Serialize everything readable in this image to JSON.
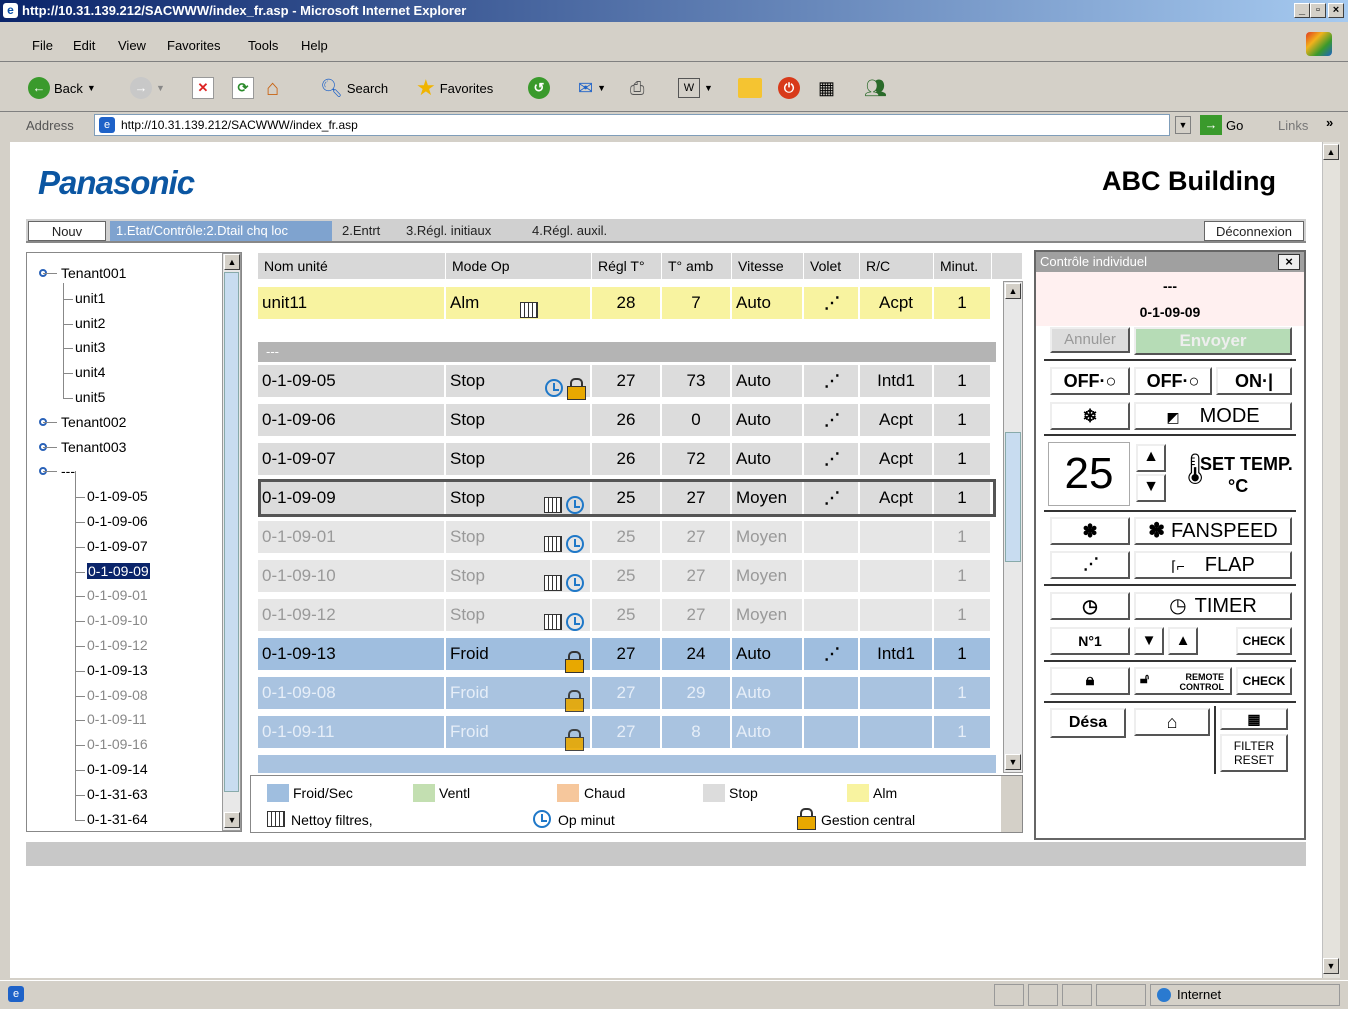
{
  "window": {
    "title": "http://10.31.139.212/SACWWW/index_fr.asp - Microsoft Internet Explorer"
  },
  "menu": [
    "File",
    "Edit",
    "View",
    "Favorites",
    "Tools",
    "Help"
  ],
  "toolbar": {
    "back": "Back",
    "search": "Search",
    "favorites": "Favorites"
  },
  "address": {
    "label": "Address",
    "url": "http://10.31.139.212/SACWWW/index_fr.asp",
    "go": "Go",
    "links": "Links"
  },
  "page": {
    "logo": "Panasonic",
    "building": "ABC Building"
  },
  "tabs": {
    "nouv": "Nouv",
    "etat": "1.Etat/Contrôle:2.Dtail chq loc",
    "entrt": "2.Entrt",
    "regl_init": "3.Régl. initiaux",
    "regl_aux": "4.Régl. auxil.",
    "logout": "Déconnexion"
  },
  "tree": [
    {
      "label": "Tenant001",
      "level": 0,
      "state": "normal"
    },
    {
      "label": "unit1",
      "level": 1,
      "state": "normal"
    },
    {
      "label": "unit2",
      "level": 1,
      "state": "normal"
    },
    {
      "label": "unit3",
      "level": 1,
      "state": "normal"
    },
    {
      "label": "unit4",
      "level": 1,
      "state": "normal"
    },
    {
      "label": "unit5",
      "level": 1,
      "state": "normal"
    },
    {
      "label": "Tenant002",
      "level": 0,
      "state": "normal"
    },
    {
      "label": "Tenant003",
      "level": 0,
      "state": "normal"
    },
    {
      "label": "---",
      "level": 0,
      "state": "normal"
    },
    {
      "label": "0-1-09-05",
      "level": 2,
      "state": "normal"
    },
    {
      "label": "0-1-09-06",
      "level": 2,
      "state": "normal"
    },
    {
      "label": "0-1-09-07",
      "level": 2,
      "state": "normal"
    },
    {
      "label": "0-1-09-09",
      "level": 2,
      "state": "selected"
    },
    {
      "label": "0-1-09-01",
      "level": 2,
      "state": "dim"
    },
    {
      "label": "0-1-09-10",
      "level": 2,
      "state": "dim"
    },
    {
      "label": "0-1-09-12",
      "level": 2,
      "state": "dim"
    },
    {
      "label": "0-1-09-13",
      "level": 2,
      "state": "normal"
    },
    {
      "label": "0-1-09-08",
      "level": 2,
      "state": "dim"
    },
    {
      "label": "0-1-09-11",
      "level": 2,
      "state": "dim"
    },
    {
      "label": "0-1-09-16",
      "level": 2,
      "state": "dim"
    },
    {
      "label": "0-1-09-14",
      "level": 2,
      "state": "normal"
    },
    {
      "label": "0-1-31-63",
      "level": 2,
      "state": "normal"
    },
    {
      "label": "0-1-31-64",
      "level": 2,
      "state": "normal"
    }
  ],
  "grid": {
    "headers": [
      "Nom unité",
      "Mode Op",
      "Régl T°",
      "T° amb",
      "Vitesse",
      "Volet",
      "R/C",
      "Minut."
    ],
    "group_label": "---",
    "rows": [
      {
        "name": "unit11",
        "mode": "Alm",
        "icons": [
          "filter"
        ],
        "set": "28",
        "amb": "7",
        "speed": "Auto",
        "flap": true,
        "rc": "Acpt",
        "timer": "1",
        "style": "alarm"
      },
      {
        "name": "0-1-09-05",
        "mode": "Stop",
        "icons": [
          "clock",
          "lock"
        ],
        "set": "27",
        "amb": "73",
        "speed": "Auto",
        "flap": true,
        "rc": "Intd1",
        "timer": "1",
        "style": "stop"
      },
      {
        "name": "0-1-09-06",
        "mode": "Stop",
        "icons": [],
        "set": "26",
        "amb": "0",
        "speed": "Auto",
        "flap": true,
        "rc": "Acpt",
        "timer": "1",
        "style": "stop"
      },
      {
        "name": "0-1-09-07",
        "mode": "Stop",
        "icons": [],
        "set": "26",
        "amb": "72",
        "speed": "Auto",
        "flap": true,
        "rc": "Acpt",
        "timer": "1",
        "style": "stop"
      },
      {
        "name": "0-1-09-09",
        "mode": "Stop",
        "icons": [
          "filter",
          "clock"
        ],
        "set": "25",
        "amb": "27",
        "speed": "Moyen",
        "flap": true,
        "rc": "Acpt",
        "timer": "1",
        "style": "selected"
      },
      {
        "name": "0-1-09-01",
        "mode": "Stop",
        "icons": [
          "filter",
          "clock"
        ],
        "set": "25",
        "amb": "27",
        "speed": "Moyen",
        "flap": false,
        "rc": "",
        "timer": "1",
        "style": "stopdim"
      },
      {
        "name": "0-1-09-10",
        "mode": "Stop",
        "icons": [
          "filter",
          "clock"
        ],
        "set": "25",
        "amb": "27",
        "speed": "Moyen",
        "flap": false,
        "rc": "",
        "timer": "1",
        "style": "stopdim"
      },
      {
        "name": "0-1-09-12",
        "mode": "Stop",
        "icons": [
          "filter",
          "clock"
        ],
        "set": "25",
        "amb": "27",
        "speed": "Moyen",
        "flap": false,
        "rc": "",
        "timer": "1",
        "style": "stopdim"
      },
      {
        "name": "0-1-09-13",
        "mode": "Froid",
        "icons": [
          "lock"
        ],
        "set": "27",
        "amb": "24",
        "speed": "Auto",
        "flap": true,
        "rc": "Intd1",
        "timer": "1",
        "style": "cool"
      },
      {
        "name": "0-1-09-08",
        "mode": "Froid",
        "icons": [
          "lock"
        ],
        "set": "27",
        "amb": "29",
        "speed": "Auto",
        "flap": false,
        "rc": "",
        "timer": "1",
        "style": "cooldim"
      },
      {
        "name": "0-1-09-11",
        "mode": "Froid",
        "icons": [
          "lock"
        ],
        "set": "27",
        "amb": "8",
        "speed": "Auto",
        "flap": false,
        "rc": "",
        "timer": "1",
        "style": "cooldim"
      }
    ]
  },
  "legend": {
    "froid": "Froid/Sec",
    "ventl": "Ventl",
    "chaud": "Chaud",
    "stop": "Stop",
    "alm": "Alm",
    "filters": "Nettoy filtres,",
    "timer": "Op minut",
    "central": "Gestion central"
  },
  "panel": {
    "title": "Contrôle individuel",
    "dashes": "---",
    "unit": "0-1-09-09",
    "cancel": "Annuler",
    "send": "Envoyer",
    "off1": "OFF·○",
    "off2": "OFF·○",
    "on": "ON·|",
    "mode": "MODE",
    "temp": "25",
    "set_temp": "SET TEMP.",
    "unit_c": "°C",
    "fanspeed": "FANSPEED",
    "flap": "FLAP",
    "timer": "TIMER",
    "no1": "N°1",
    "check1": "CHECK",
    "remote1": "REMOTE",
    "remote2": "CONTROL",
    "check2": "CHECK",
    "desa": "Désa",
    "filter1": "FILTER",
    "filter2": "RESET"
  },
  "status": {
    "zone": "Internet"
  },
  "colors": {
    "cool": "#9fbedf",
    "fan": "#c3dfb1",
    "heat": "#f6c79c",
    "stop": "#dcdcdc",
    "alarm": "#f8f3a0"
  }
}
